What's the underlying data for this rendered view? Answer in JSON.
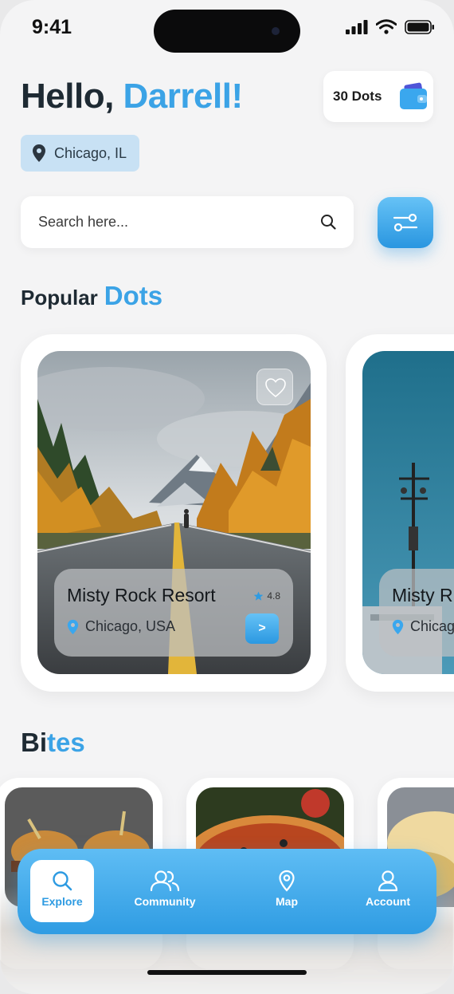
{
  "status_bar": {
    "time": "9:41"
  },
  "header": {
    "greeting": "Hello,",
    "user_name": "Darrell!",
    "wallet_label": "30 Dots",
    "location": "Chicago, IL"
  },
  "search": {
    "placeholder": "Search here..."
  },
  "sections": {
    "popular_word": "Popular",
    "popular_accent": "Dots",
    "bites_black": "Bi",
    "bites_accent": "tes"
  },
  "dots": [
    {
      "title": "Misty Rock Resort",
      "rating": "4.8",
      "place": "Chicago, USA",
      "go": ">"
    },
    {
      "title": "Misty R",
      "place": "Chicag"
    }
  ],
  "nav": [
    {
      "label": "Explore",
      "icon": "search-icon",
      "active": true
    },
    {
      "label": "Community",
      "icon": "users-icon",
      "active": false
    },
    {
      "label": "Map",
      "icon": "map-pin-icon",
      "active": false
    },
    {
      "label": "Account",
      "icon": "user-icon",
      "active": false
    }
  ],
  "colors": {
    "accent": "#3ba3e6",
    "nav_top": "#5fbdf4",
    "nav_bottom": "#2f9ce3",
    "location_chip": "#c8e1f4"
  }
}
